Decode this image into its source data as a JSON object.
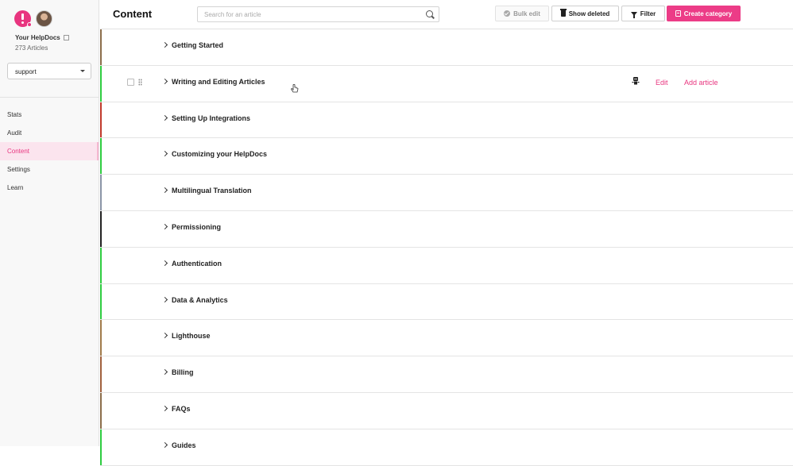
{
  "sidebar": {
    "site_name": "Your HelpDocs",
    "article_count": "273 Articles",
    "selected_version": "support",
    "nav": [
      {
        "label": "Stats",
        "active": false
      },
      {
        "label": "Audit",
        "active": false
      },
      {
        "label": "Content",
        "active": true
      },
      {
        "label": "Settings",
        "active": false
      },
      {
        "label": "Learn",
        "active": false
      }
    ]
  },
  "header": {
    "title": "Content",
    "search_placeholder": "Search for an article",
    "bulk_edit_label": "Bulk edit",
    "show_deleted_label": "Show deleted",
    "filter_label": "Filter",
    "create_category_label": "Create category"
  },
  "row_actions": {
    "edit_label": "Edit",
    "add_article_label": "Add article"
  },
  "categories": [
    {
      "title": "Getting Started",
      "color": "#8b6d4a"
    },
    {
      "title": "Writing and Editing Articles",
      "color": "#2ecc40"
    },
    {
      "title": "Setting Up Integrations",
      "color": "#c0392b"
    },
    {
      "title": "Customizing your HelpDocs",
      "color": "#2ecc40"
    },
    {
      "title": "Multilingual Translation",
      "color": "#8a94a6"
    },
    {
      "title": "Permissioning",
      "color": "#222222"
    },
    {
      "title": "Authentication",
      "color": "#2ecc40"
    },
    {
      "title": "Data & Analytics",
      "color": "#2ecc40"
    },
    {
      "title": "Lighthouse",
      "color": "#a07a4a"
    },
    {
      "title": "Billing",
      "color": "#a0603d"
    },
    {
      "title": "FAQs",
      "color": "#8b6d4a"
    },
    {
      "title": "Guides",
      "color": "#2ecc40"
    }
  ],
  "colors": {
    "accent": "#ec3c87",
    "active_nav_bg": "#fbe4ee"
  }
}
